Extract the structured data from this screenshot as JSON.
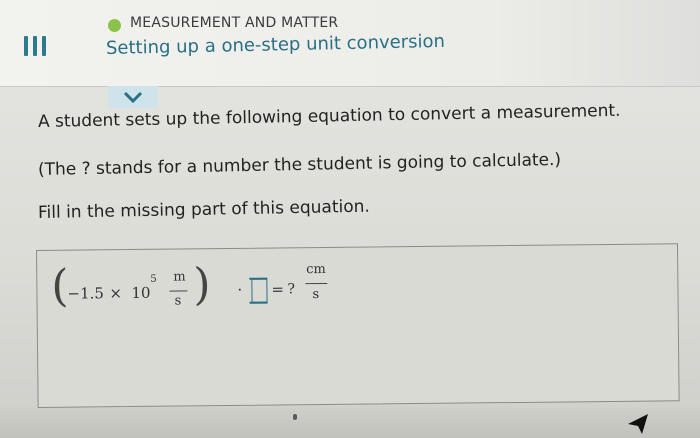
{
  "header": {
    "topic": "MEASUREMENT AND MATTER",
    "title": "Setting up a one-step unit conversion",
    "status_color": "#8ac34a",
    "accent": "#2a6f86"
  },
  "question": {
    "line1": "A student sets up the following equation to convert a measurement.",
    "line2": "(The ? stands for a number the student is going to calculate.)",
    "line3": "Fill in the missing part of this equation."
  },
  "equation": {
    "open_paren": "(",
    "coefficient": "−1.5",
    "times": "×",
    "base": "10",
    "exponent": "5",
    "left_num": "m",
    "left_den": "s",
    "close_paren": ")",
    "dot": "·",
    "equals": "=",
    "unknown": "?",
    "right_num": "cm",
    "right_den": "s"
  },
  "icons": [
    "menu-icon",
    "chevron-down-icon",
    "cursor-icon"
  ]
}
